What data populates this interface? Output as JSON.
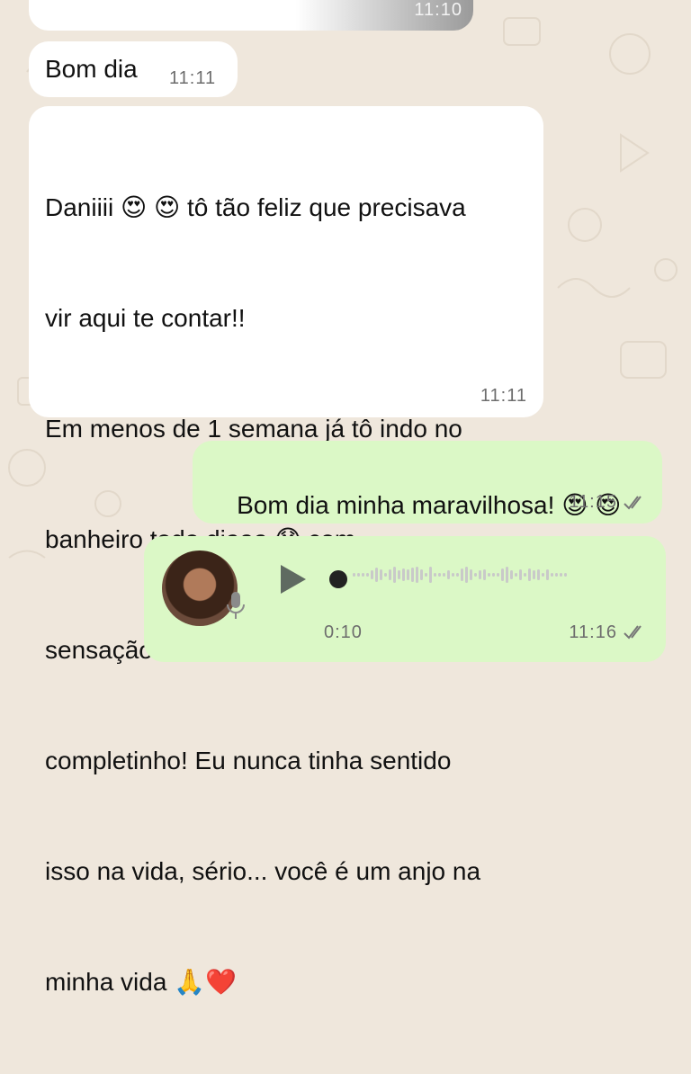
{
  "chat": {
    "prev_message": {
      "time": "11:10"
    },
    "msg1": {
      "text": "Bom dia",
      "time": "11:11"
    },
    "msg2": {
      "line1_a": "Daniiii",
      "line1_b": "tô tão feliz que precisava",
      "line2": "vir aqui te contar!!",
      "line3": "Em menos de 1 semana já tô indo no",
      "line4_a": "banheiro todo diaaa",
      "line4_b": "com",
      "line5": "sensação de esvaziamento",
      "line6": "completinho! Eu nunca tinha sentido",
      "line7": "isso na vida, sério... você é um anjo na",
      "line8": "minha vida",
      "time": "11:11"
    },
    "msg3": {
      "text": "Bom dia minha maravilhosa!",
      "time": "11:15"
    },
    "voice": {
      "duration": "0:10",
      "time": "11:16"
    }
  },
  "icons": {
    "emoji_heart_eyes": "😍",
    "emoji_scream": "😱",
    "emoji_pray": "🙏",
    "emoji_heart": "❤️",
    "read_receipt": "double-check-icon",
    "play": "play-icon",
    "mic": "mic-icon"
  },
  "colors": {
    "incoming_bubble": "#ffffff",
    "outgoing_bubble": "#dbf8c6",
    "background": "#efe7dc",
    "timestamp": "#6d6d6d"
  }
}
